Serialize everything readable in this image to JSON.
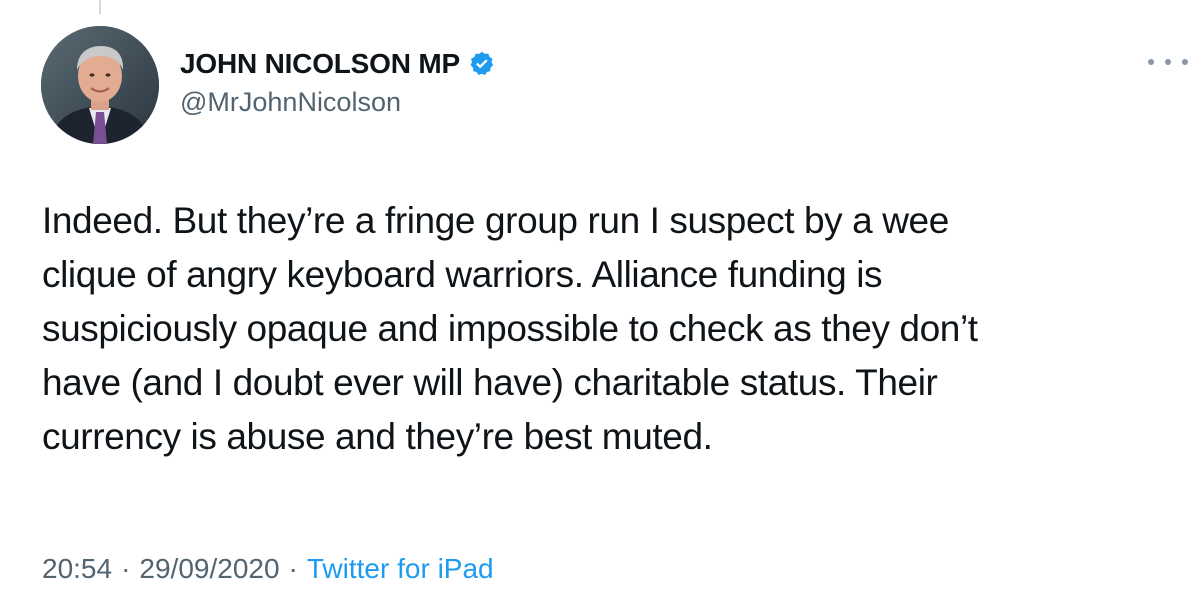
{
  "tweet": {
    "author": {
      "display_name": "JOHN NICOLSON MP",
      "handle": "@MrJohnNicolson",
      "verified": true,
      "avatar_icon": "profile-photo-icon",
      "verified_icon": "verified-badge-icon"
    },
    "text_lines": [
      "Indeed. But they’re a fringe group run I suspect by a wee",
      "clique of angry keyboard warriors. Alliance funding is",
      "suspiciously opaque and impossible to check as they don’t",
      "have (and I doubt ever will have) charitable status. Their",
      "currency is abuse and they’re best muted."
    ],
    "time": "20:54",
    "date": "29/09/2020",
    "separator": "·",
    "source": "Twitter for iPad",
    "more_icon": "more-options-icon"
  },
  "colors": {
    "text_primary": "#0f1419",
    "text_secondary": "#536471",
    "link": "#1d9bf0",
    "verified": "#1d9bf0"
  }
}
